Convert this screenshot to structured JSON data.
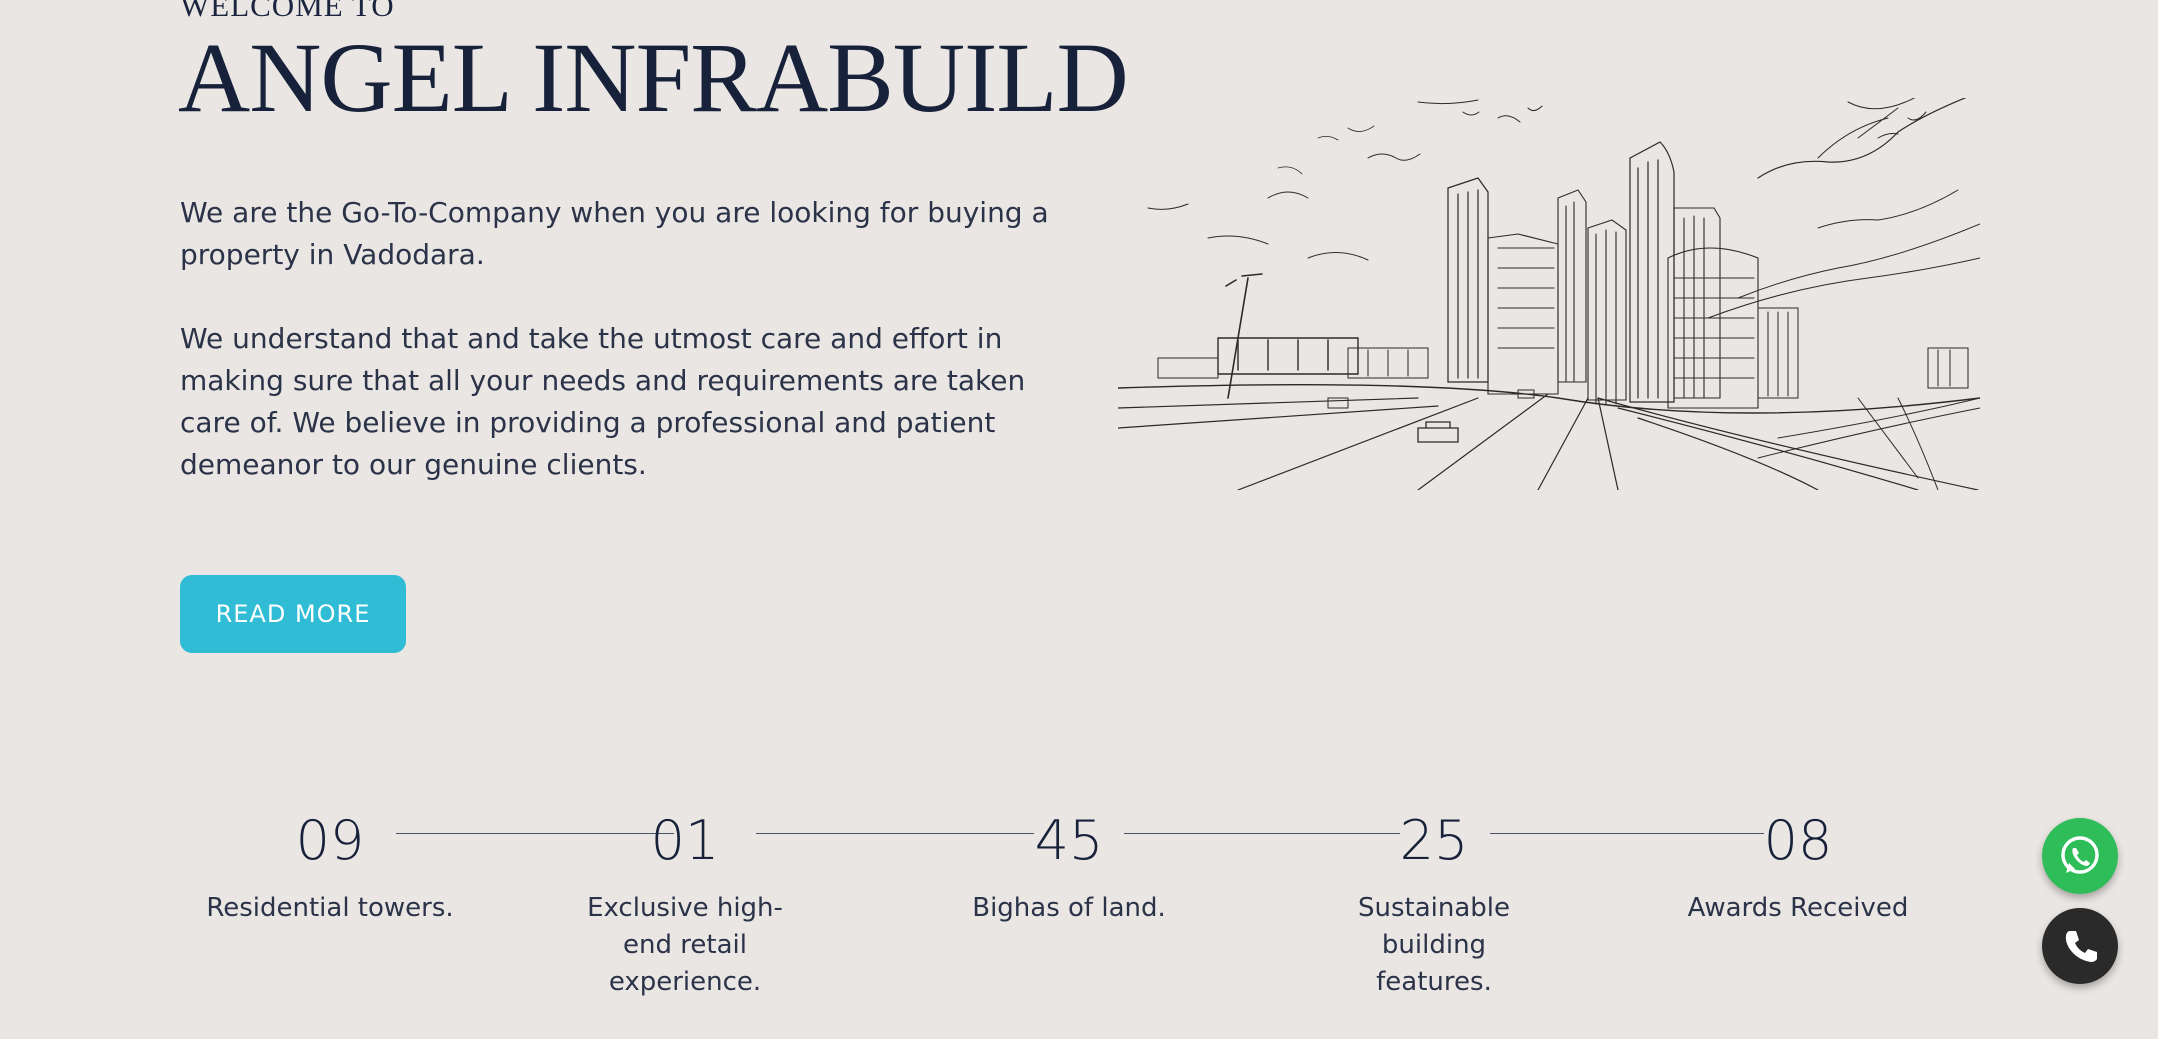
{
  "hero": {
    "welcome": "WELCOME TO",
    "brand": "ANGEL INFRABUILD",
    "paragraph_1": "We are the Go-To-Company when you are looking for buying a property in Vadodara.",
    "paragraph_2": "We understand that and take the utmost care and effort in making sure that all your needs and requirements are taken care of. We believe in providing a professional and patient demeanor to our genuine clients.",
    "read_more_label": "READ MORE",
    "illustration_icon": "city-skyline-sketch"
  },
  "stats": [
    {
      "value": "09",
      "label": "Residential towers."
    },
    {
      "value": "01",
      "label": "Exclusive high-end retail experience."
    },
    {
      "value": "45",
      "label": "Bighas of land."
    },
    {
      "value": "25",
      "label": "Sustainable building features."
    },
    {
      "value": "08",
      "label": "Awards Received"
    }
  ],
  "floating_buttons": {
    "whatsapp_icon": "whatsapp-icon",
    "whatsapp_color": "#2ebd58",
    "phone_icon": "phone-icon",
    "phone_color": "#2a2a2a"
  },
  "colors": {
    "background": "#eae6e3",
    "text_dark": "#17213a",
    "accent": "#2fbcd4"
  }
}
